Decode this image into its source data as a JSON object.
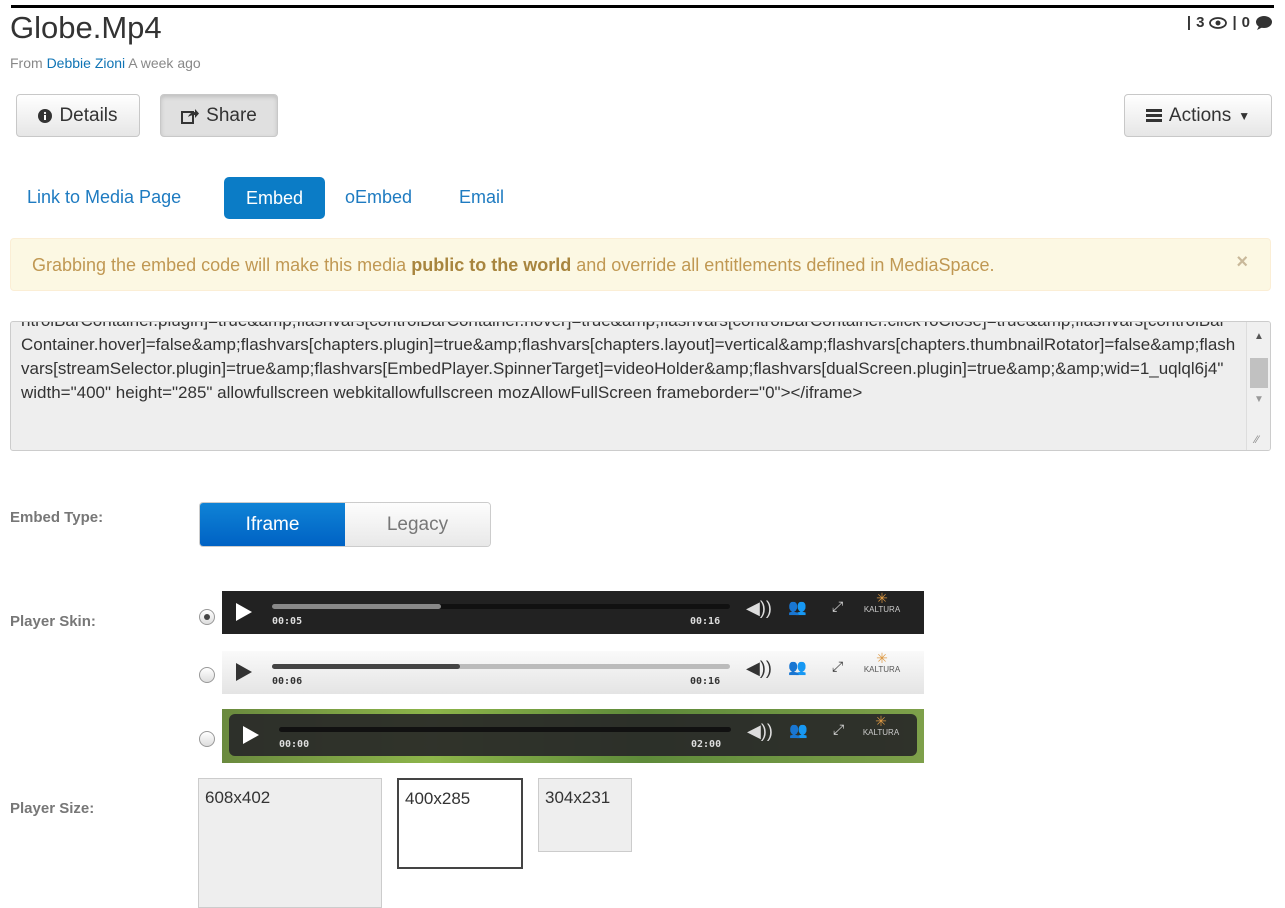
{
  "header": {
    "title": "Globe.Mp4",
    "from_label": "From",
    "author": "Debbie Zioni",
    "time": "A week ago",
    "views": "3",
    "comments": "0"
  },
  "toolbar": {
    "details_label": "Details",
    "share_label": "Share",
    "actions_label": "Actions"
  },
  "share_tabs": [
    {
      "label": "Link to Media Page"
    },
    {
      "label": "Embed",
      "selected": true
    },
    {
      "label": "oEmbed"
    },
    {
      "label": "Email"
    }
  ],
  "alert": {
    "text_before": "Grabbing the embed code will make this media",
    "bold": "public to the world",
    "text_after": "and override all entitlements defined in MediaSpace.",
    "close": "×"
  },
  "embed_code": "ntrolBarContainer.plugin]=true&amp;flashvars[controlBarContainer.hover]=true&amp;flashvars[controlBarContainer.clickToClose]=true&amp;flashvars[controlBarContainer.hover]=false&amp;flashvars[chapters.plugin]=true&amp;flashvars[chapters.layout]=vertical&amp;flashvars[chapters.thumbnailRotator]=false&amp;flashvars[streamSelector.plugin]=true&amp;flashvars[EmbedPlayer.SpinnerTarget]=videoHolder&amp;flashvars[dualScreen.plugin]=true&amp;&amp;wid=1_uqlql6j4\" width=\"400\" height=\"285\" allowfullscreen webkitallowfullscreen mozAllowFullScreen frameborder=\"0\"></iframe>",
  "embed_type": {
    "label": "Embed Type:",
    "options": [
      "Iframe",
      "Legacy"
    ],
    "selected": "Iframe"
  },
  "player_skin": {
    "label": "Player Skin:",
    "skins": [
      {
        "time_current": "00:05",
        "time_total": "00:16",
        "progress": 0.37,
        "selected": true,
        "logo": "KALTURA"
      },
      {
        "time_current": "00:06",
        "time_total": "00:16",
        "progress": 0.41,
        "selected": false,
        "logo": "KALTURA"
      },
      {
        "time_current": "00:00",
        "time_total": "02:00",
        "progress": 0.0,
        "selected": false,
        "logo": "KALTURA"
      }
    ]
  },
  "player_size": {
    "label": "Player Size:",
    "options": [
      "608x402",
      "400x285",
      "304x231"
    ],
    "selected": "400x285"
  },
  "colors": {
    "link": "#0f74b5",
    "accent": "#0b7cc6",
    "alert_bg": "#fcf8e3",
    "alert_text": "#c09853"
  }
}
